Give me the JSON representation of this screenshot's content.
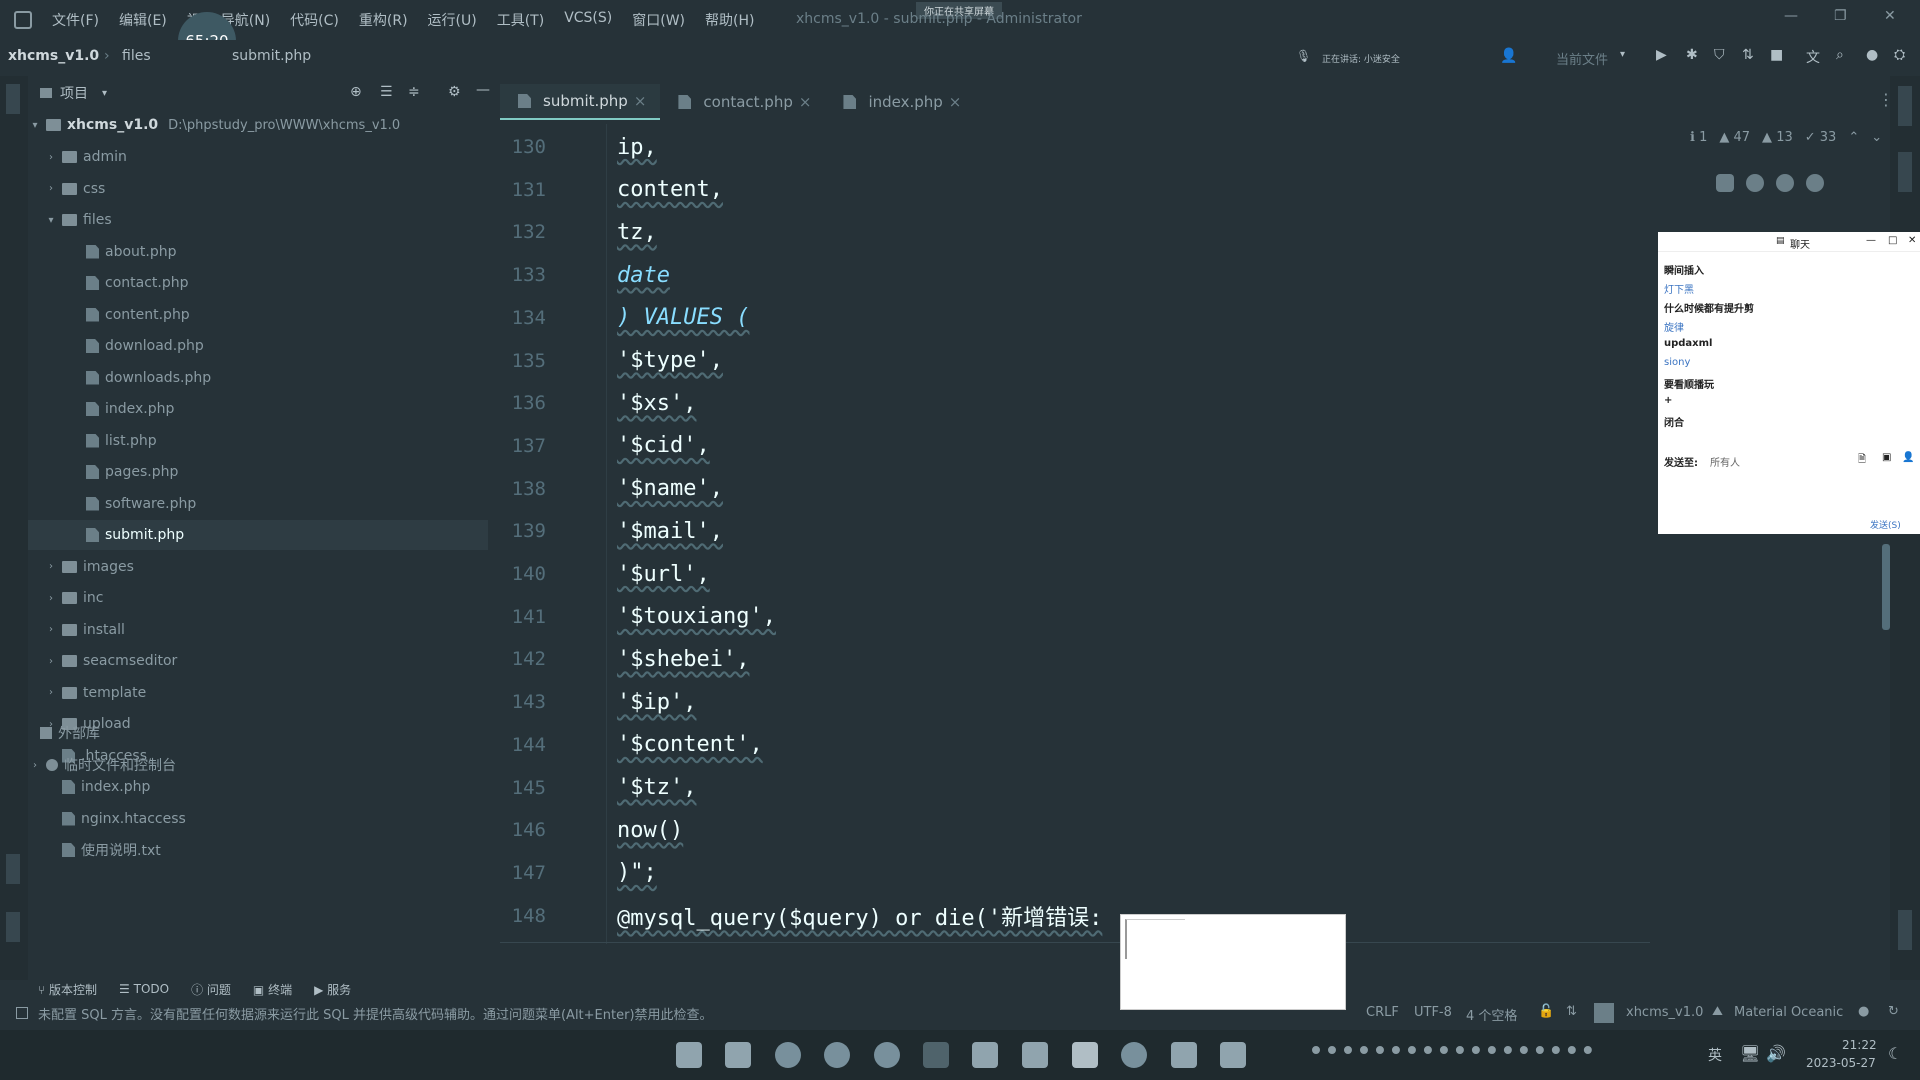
{
  "titlebar": {
    "menu": [
      "文件(F)",
      "编辑(E)",
      "视",
      "导航(N)",
      "代码(C)",
      "重构(R)",
      "运行(U)",
      "工具(T)",
      "VCS(S)",
      "窗口(W)",
      "帮助(H)"
    ],
    "title": "xhcms_v1.0 - submit.php - Administrator",
    "share_banner": "你正在共享屏幕",
    "timer": "65:20"
  },
  "navbar": {
    "breadcrumb": [
      "xhcms_v1.0",
      "files",
      "submit.php"
    ],
    "speaking": "正在讲话: 小迷安全",
    "run_config": "当前文件"
  },
  "project": {
    "title": "项目",
    "root_name": "xhcms_v1.0",
    "root_path": "D:\\phpstudy_pro\\WWW\\xhcms_v1.0",
    "items": [
      {
        "label": "admin",
        "type": "folder",
        "depth": 1,
        "expanded": false
      },
      {
        "label": "css",
        "type": "folder",
        "depth": 1,
        "expanded": false
      },
      {
        "label": "files",
        "type": "folder",
        "depth": 1,
        "expanded": true
      },
      {
        "label": "about.php",
        "type": "php",
        "depth": 2
      },
      {
        "label": "contact.php",
        "type": "php",
        "depth": 2
      },
      {
        "label": "content.php",
        "type": "php",
        "depth": 2
      },
      {
        "label": "download.php",
        "type": "php",
        "depth": 2
      },
      {
        "label": "downloads.php",
        "type": "php",
        "depth": 2
      },
      {
        "label": "index.php",
        "type": "php",
        "depth": 2
      },
      {
        "label": "list.php",
        "type": "php",
        "depth": 2
      },
      {
        "label": "pages.php",
        "type": "php",
        "depth": 2
      },
      {
        "label": "software.php",
        "type": "php",
        "depth": 2
      },
      {
        "label": "submit.php",
        "type": "php",
        "depth": 2,
        "selected": true
      },
      {
        "label": "images",
        "type": "folder",
        "depth": 1,
        "expanded": false
      },
      {
        "label": "inc",
        "type": "folder",
        "depth": 1,
        "expanded": false
      },
      {
        "label": "install",
        "type": "folder",
        "depth": 1,
        "expanded": false
      },
      {
        "label": "seacmseditor",
        "type": "folder",
        "depth": 1,
        "expanded": false
      },
      {
        "label": "template",
        "type": "folder",
        "depth": 1,
        "expanded": false
      },
      {
        "label": "upload",
        "type": "folder",
        "depth": 1,
        "expanded": false
      },
      {
        "label": ".htaccess",
        "type": "file",
        "depth": 1
      },
      {
        "label": "index.php",
        "type": "php",
        "depth": 1
      },
      {
        "label": "nginx.htaccess",
        "type": "file",
        "depth": 1
      },
      {
        "label": "使用说明.txt",
        "type": "file",
        "depth": 1
      }
    ],
    "external_libs": "外部库",
    "scratches": "临时文件和控制台"
  },
  "tabs": [
    {
      "label": "submit.php",
      "active": true
    },
    {
      "label": "contact.php",
      "active": false
    },
    {
      "label": "index.php",
      "active": false
    }
  ],
  "inspections": {
    "info": "1",
    "warn1": "47",
    "warn2": "13",
    "typo": "33"
  },
  "code_lines": [
    {
      "num": "130",
      "text": "ip,",
      "kw": false
    },
    {
      "num": "131",
      "text": "content,",
      "kw": false
    },
    {
      "num": "132",
      "text": "tz,",
      "kw": false
    },
    {
      "num": "133",
      "text": "date",
      "kw": true
    },
    {
      "num": "134",
      "text": ") VALUES (",
      "kw": true
    },
    {
      "num": "135",
      "text": "'$type',",
      "kw": false
    },
    {
      "num": "136",
      "text": "'$xs',",
      "kw": false
    },
    {
      "num": "137",
      "text": "'$cid',",
      "kw": false
    },
    {
      "num": "138",
      "text": "'$name',",
      "kw": false
    },
    {
      "num": "139",
      "text": "'$mail',",
      "kw": false
    },
    {
      "num": "140",
      "text": "'$url',",
      "kw": false
    },
    {
      "num": "141",
      "text": "'$touxiang',",
      "kw": false
    },
    {
      "num": "142",
      "text": "'$shebei',",
      "kw": false
    },
    {
      "num": "143",
      "text": "'$ip',",
      "kw": false
    },
    {
      "num": "144",
      "text": "'$content',",
      "kw": false
    },
    {
      "num": "145",
      "text": "'$tz',",
      "kw": false
    },
    {
      "num": "146",
      "text": "now()",
      "kw": false
    },
    {
      "num": "147",
      "text": ")\";",
      "kw": false
    },
    {
      "num": "148",
      "text": "@mysql_query($query) or die('新增错误:",
      "kw": false
    }
  ],
  "chat": {
    "title": "聊天",
    "messages": [
      "瞬间插入",
      "灯下黑",
      "什么时候都有提升剪",
      "旋律",
      "updaxml",
      "siony",
      "要看顺播玩",
      "+",
      "闭合"
    ],
    "send_to_label": "发送至:",
    "send_to_value": "所有人",
    "send_button": "发送(S)"
  },
  "toolbar": [
    "版本控制",
    "TODO",
    "问题",
    "终端",
    "服务"
  ],
  "status": {
    "message": "未配置 SQL 方言。没有配置任何数据源来运行此 SQL 并提供高级代码辅助。通过问题菜单(Alt+Enter)禁用此检查。",
    "line_sep": "CRLF",
    "encoding": "UTF-8",
    "indent": "4 个空格",
    "project": "xhcms_v1.0",
    "theme": "Material Oceanic"
  },
  "taskbar": {
    "time": "21:22",
    "date": "2023-05-27",
    "ime": "英"
  }
}
